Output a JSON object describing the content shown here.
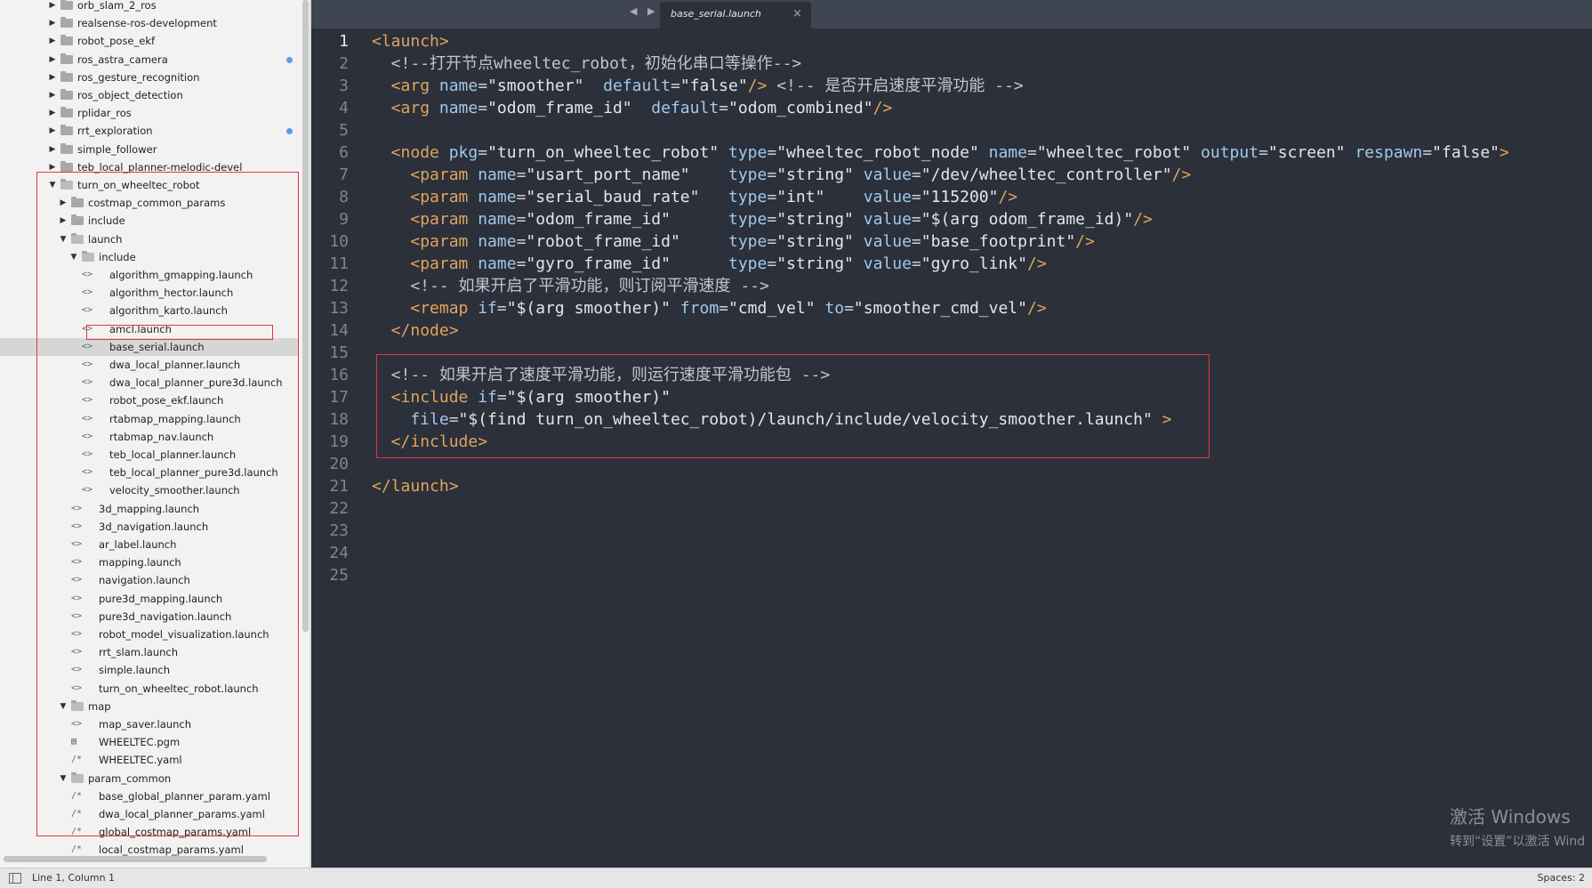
{
  "sidebar": {
    "items": [
      {
        "label": "orb_slam_2_ros",
        "kind": "folder",
        "open": false,
        "depth": 1
      },
      {
        "label": "realsense-ros-development",
        "kind": "folder",
        "open": false,
        "depth": 1
      },
      {
        "label": "robot_pose_ekf",
        "kind": "folder",
        "open": false,
        "depth": 1
      },
      {
        "label": "ros_astra_camera",
        "kind": "folder",
        "open": false,
        "depth": 1,
        "dot": true
      },
      {
        "label": "ros_gesture_recognition",
        "kind": "folder",
        "open": false,
        "depth": 1
      },
      {
        "label": "ros_object_detection",
        "kind": "folder",
        "open": false,
        "depth": 1
      },
      {
        "label": "rplidar_ros",
        "kind": "folder",
        "open": false,
        "depth": 1
      },
      {
        "label": "rrt_exploration",
        "kind": "folder",
        "open": false,
        "depth": 1,
        "dot": true
      },
      {
        "label": "simple_follower",
        "kind": "folder",
        "open": false,
        "depth": 1
      },
      {
        "label": "teb_local_planner-melodic-devel",
        "kind": "folder",
        "open": false,
        "depth": 1
      },
      {
        "label": "turn_on_wheeltec_robot",
        "kind": "folder",
        "open": true,
        "depth": 1
      },
      {
        "label": "costmap_common_params",
        "kind": "folder",
        "open": false,
        "depth": 2
      },
      {
        "label": "include",
        "kind": "folder",
        "open": false,
        "depth": 2
      },
      {
        "label": "launch",
        "kind": "folder",
        "open": true,
        "depth": 2
      },
      {
        "label": "include",
        "kind": "folder",
        "open": true,
        "depth": 3
      },
      {
        "label": "algorithm_gmapping.launch",
        "kind": "xml",
        "depth": 4
      },
      {
        "label": "algorithm_hector.launch",
        "kind": "xml",
        "depth": 4
      },
      {
        "label": "algorithm_karto.launch",
        "kind": "xml",
        "depth": 4
      },
      {
        "label": "amcl.launch",
        "kind": "xml",
        "depth": 4
      },
      {
        "label": "base_serial.launch",
        "kind": "xml",
        "depth": 4,
        "selected": true
      },
      {
        "label": "dwa_local_planner.launch",
        "kind": "xml",
        "depth": 4
      },
      {
        "label": "dwa_local_planner_pure3d.launch",
        "kind": "xml",
        "depth": 4
      },
      {
        "label": "robot_pose_ekf.launch",
        "kind": "xml",
        "depth": 4
      },
      {
        "label": "rtabmap_mapping.launch",
        "kind": "xml",
        "depth": 4
      },
      {
        "label": "rtabmap_nav.launch",
        "kind": "xml",
        "depth": 4
      },
      {
        "label": "teb_local_planner.launch",
        "kind": "xml",
        "depth": 4
      },
      {
        "label": "teb_local_planner_pure3d.launch",
        "kind": "xml",
        "depth": 4
      },
      {
        "label": "velocity_smoother.launch",
        "kind": "xml",
        "depth": 4
      },
      {
        "label": "3d_mapping.launch",
        "kind": "xml",
        "depth": 3
      },
      {
        "label": "3d_navigation.launch",
        "kind": "xml",
        "depth": 3
      },
      {
        "label": "ar_label.launch",
        "kind": "xml",
        "depth": 3
      },
      {
        "label": "mapping.launch",
        "kind": "xml",
        "depth": 3
      },
      {
        "label": "navigation.launch",
        "kind": "xml",
        "depth": 3
      },
      {
        "label": "pure3d_mapping.launch",
        "kind": "xml",
        "depth": 3
      },
      {
        "label": "pure3d_navigation.launch",
        "kind": "xml",
        "depth": 3
      },
      {
        "label": "robot_model_visualization.launch",
        "kind": "xml",
        "depth": 3
      },
      {
        "label": "rrt_slam.launch",
        "kind": "xml",
        "depth": 3
      },
      {
        "label": "simple.launch",
        "kind": "xml",
        "depth": 3
      },
      {
        "label": "turn_on_wheeltec_robot.launch",
        "kind": "xml",
        "depth": 3
      },
      {
        "label": "map",
        "kind": "folder",
        "open": true,
        "depth": 2
      },
      {
        "label": "map_saver.launch",
        "kind": "xml",
        "depth": 3
      },
      {
        "label": "WHEELTEC.pgm",
        "kind": "image",
        "depth": 3
      },
      {
        "label": "WHEELTEC.yaml",
        "kind": "yaml",
        "depth": 3
      },
      {
        "label": "param_common",
        "kind": "folder",
        "open": true,
        "depth": 2
      },
      {
        "label": "base_global_planner_param.yaml",
        "kind": "yaml",
        "depth": 3
      },
      {
        "label": "dwa_local_planner_params.yaml",
        "kind": "yaml",
        "depth": 3
      },
      {
        "label": "global_costmap_params.yaml",
        "kind": "yaml",
        "depth": 3
      },
      {
        "label": "local_costmap_params.yaml",
        "kind": "yaml",
        "depth": 3
      }
    ]
  },
  "tab": {
    "title": "base_serial.launch",
    "close_glyph": "×",
    "nav_glyphs": "◀ ▶"
  },
  "editor": {
    "line_numbers": [
      "1",
      "2",
      "3",
      "4",
      "5",
      "6",
      "7",
      "8",
      "9",
      "10",
      "11",
      "12",
      "13",
      "14",
      "15",
      "16",
      "17",
      "18",
      "19",
      "20",
      "21",
      "22",
      "23",
      "24",
      "25"
    ],
    "lines": [
      [
        {
          "t": "<",
          "c": "tag"
        },
        {
          "t": "launch",
          "c": "tag"
        },
        {
          "t": ">",
          "c": "tag"
        }
      ],
      [
        {
          "t": "  <!--打开节点wheeltec_robot，初始化串口等操作-->",
          "c": "cm"
        }
      ],
      [
        {
          "t": "  <",
          "c": "tag"
        },
        {
          "t": "arg",
          "c": "tag"
        },
        {
          "t": " name",
          "c": "at"
        },
        {
          "t": "=",
          "c": "eq"
        },
        {
          "t": "\"smoother\"",
          "c": "st"
        },
        {
          "t": "  default",
          "c": "at"
        },
        {
          "t": "=",
          "c": "eq"
        },
        {
          "t": "\"false\"",
          "c": "st"
        },
        {
          "t": "/>",
          "c": "tag"
        },
        {
          "t": " <!-- 是否开启速度平滑功能 -->",
          "c": "cm"
        }
      ],
      [
        {
          "t": "  <",
          "c": "tag"
        },
        {
          "t": "arg",
          "c": "tag"
        },
        {
          "t": " name",
          "c": "at"
        },
        {
          "t": "=",
          "c": "eq"
        },
        {
          "t": "\"odom_frame_id\"",
          "c": "st"
        },
        {
          "t": "  default",
          "c": "at"
        },
        {
          "t": "=",
          "c": "eq"
        },
        {
          "t": "\"odom_combined\"",
          "c": "st"
        },
        {
          "t": "/>",
          "c": "tag"
        }
      ],
      [],
      [
        {
          "t": "  <",
          "c": "tag"
        },
        {
          "t": "node",
          "c": "tag"
        },
        {
          "t": " pkg",
          "c": "at"
        },
        {
          "t": "=",
          "c": "eq"
        },
        {
          "t": "\"turn_on_wheeltec_robot\"",
          "c": "st"
        },
        {
          "t": " type",
          "c": "at"
        },
        {
          "t": "=",
          "c": "eq"
        },
        {
          "t": "\"wheeltec_robot_node\"",
          "c": "st"
        },
        {
          "t": " name",
          "c": "at"
        },
        {
          "t": "=",
          "c": "eq"
        },
        {
          "t": "\"wheeltec_robot\"",
          "c": "st"
        },
        {
          "t": " output",
          "c": "at"
        },
        {
          "t": "=",
          "c": "eq"
        },
        {
          "t": "\"screen\"",
          "c": "st"
        },
        {
          "t": " respawn",
          "c": "at"
        },
        {
          "t": "=",
          "c": "eq"
        },
        {
          "t": "\"false\"",
          "c": "st"
        },
        {
          "t": ">",
          "c": "tag"
        }
      ],
      [
        {
          "t": "    <",
          "c": "tag"
        },
        {
          "t": "param",
          "c": "tag"
        },
        {
          "t": " name",
          "c": "at"
        },
        {
          "t": "=",
          "c": "eq"
        },
        {
          "t": "\"usart_port_name\"",
          "c": "st"
        },
        {
          "t": "    type",
          "c": "at"
        },
        {
          "t": "=",
          "c": "eq"
        },
        {
          "t": "\"string\"",
          "c": "st"
        },
        {
          "t": " value",
          "c": "at"
        },
        {
          "t": "=",
          "c": "eq"
        },
        {
          "t": "\"/dev/wheeltec_controller\"",
          "c": "st"
        },
        {
          "t": "/>",
          "c": "tag"
        }
      ],
      [
        {
          "t": "    <",
          "c": "tag"
        },
        {
          "t": "param",
          "c": "tag"
        },
        {
          "t": " name",
          "c": "at"
        },
        {
          "t": "=",
          "c": "eq"
        },
        {
          "t": "\"serial_baud_rate\"",
          "c": "st"
        },
        {
          "t": "   type",
          "c": "at"
        },
        {
          "t": "=",
          "c": "eq"
        },
        {
          "t": "\"int\"",
          "c": "st"
        },
        {
          "t": "    value",
          "c": "at"
        },
        {
          "t": "=",
          "c": "eq"
        },
        {
          "t": "\"115200\"",
          "c": "st"
        },
        {
          "t": "/>",
          "c": "tag"
        }
      ],
      [
        {
          "t": "    <",
          "c": "tag"
        },
        {
          "t": "param",
          "c": "tag"
        },
        {
          "t": " name",
          "c": "at"
        },
        {
          "t": "=",
          "c": "eq"
        },
        {
          "t": "\"odom_frame_id\"",
          "c": "st"
        },
        {
          "t": "      type",
          "c": "at"
        },
        {
          "t": "=",
          "c": "eq"
        },
        {
          "t": "\"string\"",
          "c": "st"
        },
        {
          "t": " value",
          "c": "at"
        },
        {
          "t": "=",
          "c": "eq"
        },
        {
          "t": "\"$(arg odom_frame_id)\"",
          "c": "st"
        },
        {
          "t": "/>",
          "c": "tag"
        }
      ],
      [
        {
          "t": "    <",
          "c": "tag"
        },
        {
          "t": "param",
          "c": "tag"
        },
        {
          "t": " name",
          "c": "at"
        },
        {
          "t": "=",
          "c": "eq"
        },
        {
          "t": "\"robot_frame_id\"",
          "c": "st"
        },
        {
          "t": "     type",
          "c": "at"
        },
        {
          "t": "=",
          "c": "eq"
        },
        {
          "t": "\"string\"",
          "c": "st"
        },
        {
          "t": " value",
          "c": "at"
        },
        {
          "t": "=",
          "c": "eq"
        },
        {
          "t": "\"base_footprint\"",
          "c": "st"
        },
        {
          "t": "/>",
          "c": "tag"
        }
      ],
      [
        {
          "t": "    <",
          "c": "tag"
        },
        {
          "t": "param",
          "c": "tag"
        },
        {
          "t": " name",
          "c": "at"
        },
        {
          "t": "=",
          "c": "eq"
        },
        {
          "t": "\"gyro_frame_id\"",
          "c": "st"
        },
        {
          "t": "      type",
          "c": "at"
        },
        {
          "t": "=",
          "c": "eq"
        },
        {
          "t": "\"string\"",
          "c": "st"
        },
        {
          "t": " value",
          "c": "at"
        },
        {
          "t": "=",
          "c": "eq"
        },
        {
          "t": "\"gyro_link\"",
          "c": "st"
        },
        {
          "t": "/>",
          "c": "tag"
        }
      ],
      [
        {
          "t": "    <!-- 如果开启了平滑功能，则订阅平滑速度 -->",
          "c": "cm"
        }
      ],
      [
        {
          "t": "    <",
          "c": "tag"
        },
        {
          "t": "remap",
          "c": "tag"
        },
        {
          "t": " if",
          "c": "at"
        },
        {
          "t": "=",
          "c": "eq"
        },
        {
          "t": "\"$(arg smoother)\"",
          "c": "st"
        },
        {
          "t": " from",
          "c": "at"
        },
        {
          "t": "=",
          "c": "eq"
        },
        {
          "t": "\"cmd_vel\"",
          "c": "st"
        },
        {
          "t": " to",
          "c": "at"
        },
        {
          "t": "=",
          "c": "eq"
        },
        {
          "t": "\"smoother_cmd_vel\"",
          "c": "st"
        },
        {
          "t": "/>",
          "c": "tag"
        }
      ],
      [
        {
          "t": "  </",
          "c": "tag"
        },
        {
          "t": "node",
          "c": "tag"
        },
        {
          "t": ">",
          "c": "tag"
        }
      ],
      [],
      [
        {
          "t": "  <!-- 如果开启了速度平滑功能，则运行速度平滑功能包 -->",
          "c": "cm"
        }
      ],
      [
        {
          "t": "  <",
          "c": "tag"
        },
        {
          "t": "include",
          "c": "tag"
        },
        {
          "t": " if",
          "c": "at"
        },
        {
          "t": "=",
          "c": "eq"
        },
        {
          "t": "\"$(arg smoother)\"",
          "c": "st"
        }
      ],
      [
        {
          "t": "    file",
          "c": "at"
        },
        {
          "t": "=",
          "c": "eq"
        },
        {
          "t": "\"$(find turn_on_wheeltec_robot)/launch/include/velocity_smoother.launch\"",
          "c": "st"
        },
        {
          "t": " >",
          "c": "tag"
        }
      ],
      [
        {
          "t": "  </",
          "c": "tag"
        },
        {
          "t": "include",
          "c": "tag"
        },
        {
          "t": ">",
          "c": "tag"
        }
      ],
      [],
      [
        {
          "t": "</",
          "c": "tag"
        },
        {
          "t": "launch",
          "c": "tag"
        },
        {
          "t": ">",
          "c": "tag"
        }
      ],
      [],
      [],
      [],
      []
    ]
  },
  "statusbar": {
    "left": "Line 1, Column 1",
    "right": "Spaces: 2"
  },
  "watermark": {
    "line1": "激活 Windows",
    "line2": "转到“设置”以激活 Wind"
  },
  "colors": {
    "tag": "#e0a55a",
    "attr": "#a3c8e8",
    "string": "#e6e6e6",
    "highlight": "#e0373d"
  }
}
